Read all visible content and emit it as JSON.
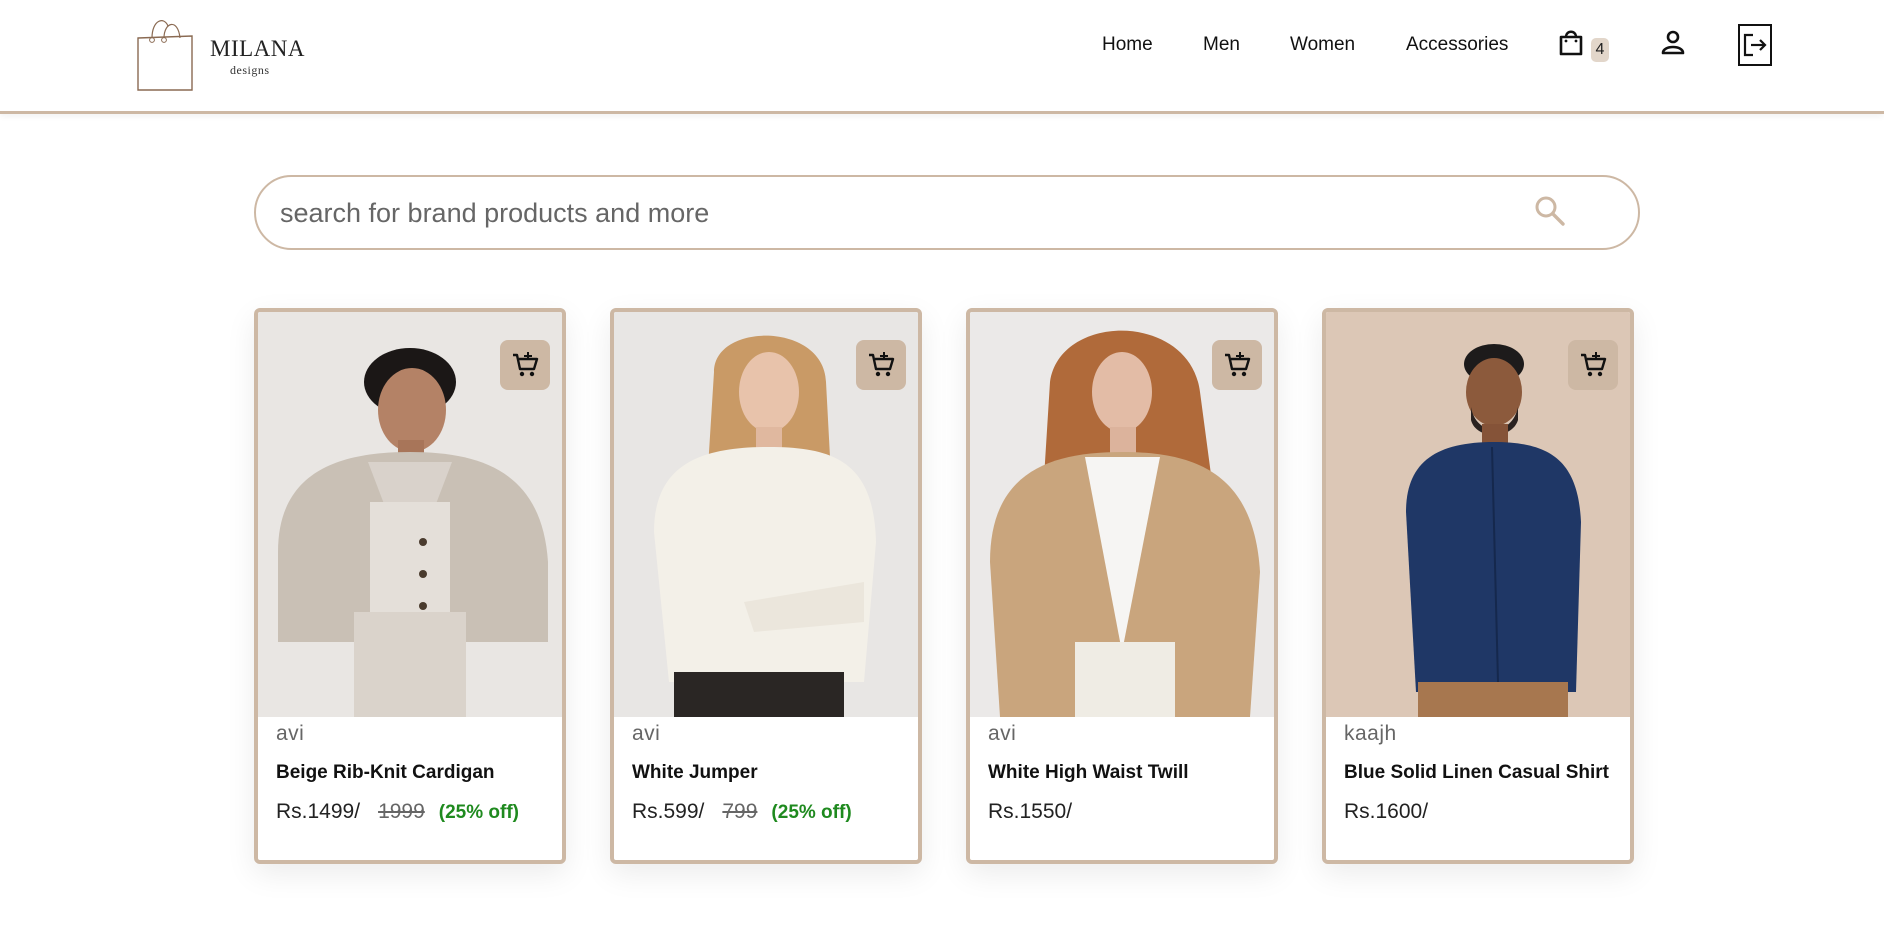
{
  "header": {
    "logo_name": "MILANA",
    "logo_sub": "designs",
    "nav": [
      "Home",
      "Men",
      "Women",
      "Accessories"
    ],
    "cart_count": "4"
  },
  "search": {
    "placeholder": "search for brand products and more"
  },
  "products": [
    {
      "brand": "avi",
      "title": "Beige Rib-Knit Cardigan",
      "price": "Rs.1499/",
      "old_price": "1999",
      "discount": "(25% off)"
    },
    {
      "brand": "avi",
      "title": "White Jumper",
      "price": "Rs.599/",
      "old_price": "799",
      "discount": "(25% off)"
    },
    {
      "brand": "avi",
      "title": "White High Waist Twill",
      "price": "Rs.1550/"
    },
    {
      "brand": "kaajh",
      "title": "Blue Solid Linen Casual Shirt",
      "price": "Rs.1600/"
    }
  ],
  "colors": {
    "accent": "#cdb8a4",
    "discount": "#1f8a1f"
  }
}
